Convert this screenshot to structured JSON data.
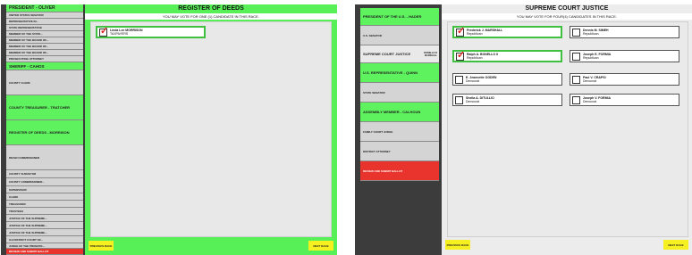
{
  "left": {
    "race_title": "REGISTER OF DEEDS",
    "instruction": "YOU MAY VOTE FOR ONE (1) CANDIDATE IN THIS RACE.",
    "prev_label": "PREVIOUS RACE",
    "next_label": "NEXT RACE",
    "candidate": {
      "name": "Linda Lee MORRISON",
      "party": "TAXPAYERS"
    },
    "sidebar": [
      "PRESIDENT - OLIVER",
      "UNITED STATES SENATOR",
      "REPRESENTATIVE IN...",
      "STATE REPRESENTATIVE",
      "MEMBER OF THE STATE...",
      "MEMBER OF THE BOARD OF...",
      "MEMBER OF THE BOARD OF...",
      "MEMBER OF THE BOARD OF...",
      "PROSECUTING ATTORNEY",
      "SHERIFF - CAHOS",
      "COUNTY CLERK",
      "COUNTY TREASURER - TRATCHER",
      "REGISTER OF DEEDS - MORRISON",
      "DRAIN COMMISSIONER",
      "COUNTY SURVEYOR",
      "COUNTY COMMISSIONER...",
      "SUPERVISOR",
      "CLERK",
      "TREASURER",
      "TRUSTEES",
      "JUSTICE OF THE SUPREME...",
      "JUSTICE OF THE SUPREME...",
      "JUSTICE OF THE SUPREME...",
      "3rd DISTRICT COURT OF...",
      "JUDGE OF THE PROBATE...",
      "REVIEW AND SUBMIT BALLOT"
    ]
  },
  "right": {
    "race_title": "SUPREME COURT JUSTICE",
    "instruction": "YOU MAY VOTE FOR FOUR(4) CANDIDATES IN THIS RACE.",
    "prev_label": "PREVIOUS RACE",
    "next_label": "NEXT RACE",
    "sidebar": [
      "PRESIDENT OF THE U.S. - HADER",
      "U.S. SENATOR",
      "SUPREME COURT JUSTICE",
      "U.S. REPRESENTATIVE - QUINN",
      "STATE SENATOR",
      "ASSEMBLY MEMBER - CALHOUN",
      "FAMILY COURT JUDGE",
      "DISTRICT ATTORNEY",
      "REVIEW AND SUBMIT BALLOT"
    ],
    "sidebar_sub": "BONELLO R\nMARSHALL",
    "candidates": [
      {
        "name": "Frederick J. MARSHALL",
        "party": "Republican"
      },
      {
        "name": "Dennis M. SIMEH",
        "party": "Republican"
      },
      {
        "name": "Ralph A. BONELLO II",
        "party": "Republican"
      },
      {
        "name": "Joseph E. FORMIA",
        "party": "Republican"
      },
      {
        "name": "E. Jeannette OGDEN",
        "party": "Democrat"
      },
      {
        "name": "Paul V. CRAPSI",
        "party": "Democrat"
      },
      {
        "name": "Sheila A. DITULLIO",
        "party": "Democrat"
      },
      {
        "name": "Joseph V. FORMIA",
        "party": "Democrat"
      }
    ]
  },
  "colors": {
    "selected_green": "#57f057",
    "review_red": "#e8342c",
    "nav_yellow": "#f6f020",
    "check_red": "#dd2222"
  }
}
